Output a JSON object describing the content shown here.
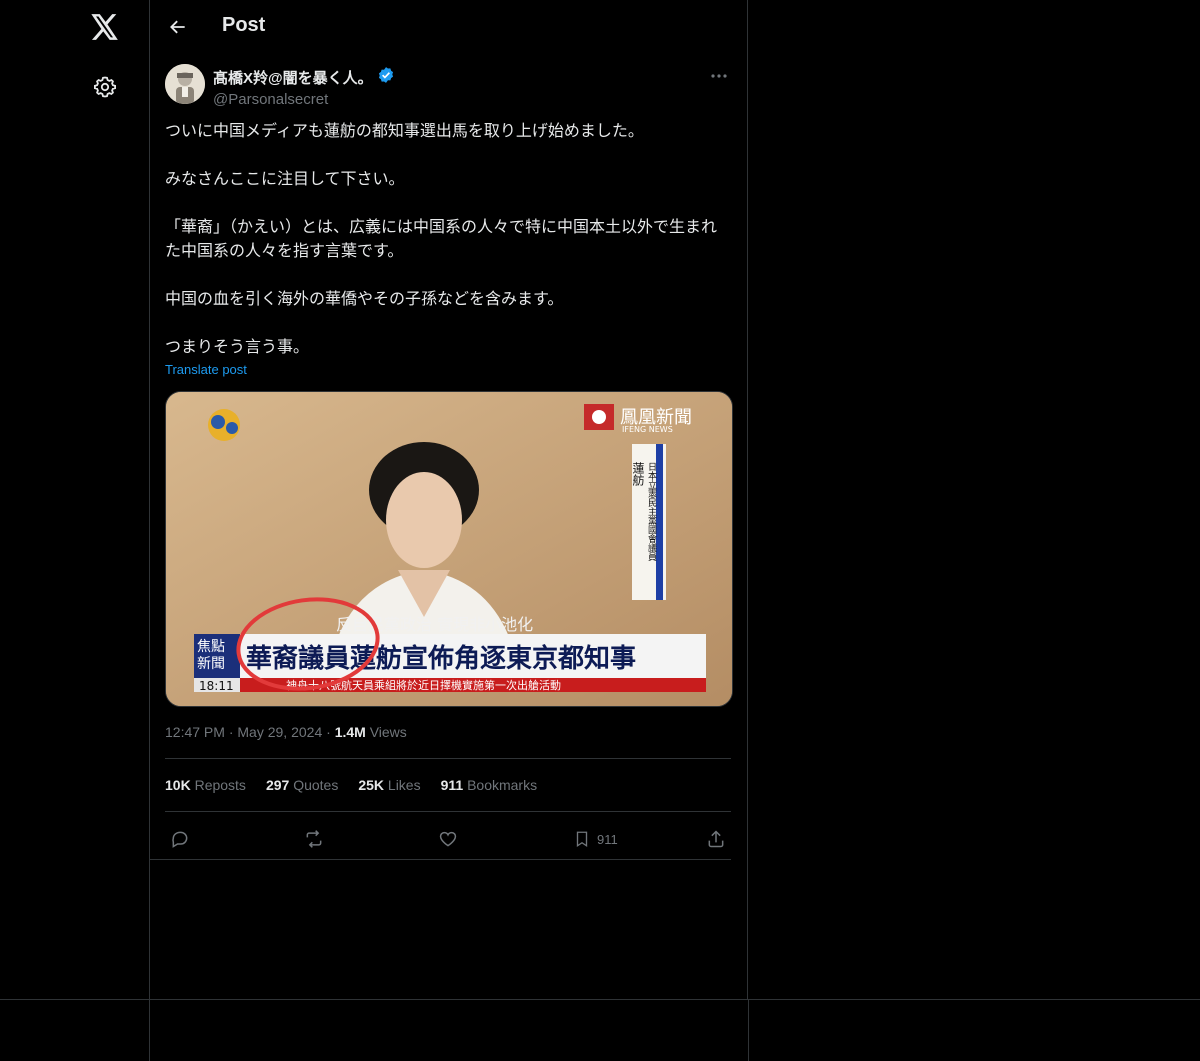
{
  "nav": {
    "logo_icon": "x-logo-icon",
    "settings_icon": "gear-icon"
  },
  "header": {
    "title": "Post"
  },
  "author": {
    "name": "髙橋X羚@闇を暴く人。",
    "handle": "@Parsonalsecret",
    "verified": true
  },
  "post": {
    "paragraphs": [
      "ついに中国メディアも蓮舫の都知事選出馬を取り上げ始めました。",
      "みなさんここに注目して下さい。",
      "「華裔」（かえい）とは、広義には中国系の人々で特に中国本土以外で生まれた中国系の人々を指す言葉です。",
      "中国の血を引く海外の華僑やその子孫などを含みます。",
      "つまりそう言う事。"
    ],
    "translate_label": "Translate post"
  },
  "media": {
    "logo_text": "鳳凰新聞",
    "logo_sub": "IFENG NEWS",
    "vertical_name": "蓮舫",
    "vertical_title": "日本立憲民主黨國會議員",
    "subtitle": "反自民黨政治 實現非小池化",
    "box_label_1": "焦點",
    "box_label_2": "新聞",
    "headline": "華裔議員蓮舫宣佈角逐東京都知事",
    "time": "18:11",
    "ticker": "神舟十八號航天員乘組將於近日擇機實施第一次出艙活動"
  },
  "meta": {
    "time": "12:47 PM",
    "date": "May 29, 2024",
    "views_count": "1.4M",
    "views_label": "Views"
  },
  "stats": [
    {
      "count": "10K",
      "label": "Reposts"
    },
    {
      "count": "297",
      "label": "Quotes"
    },
    {
      "count": "25K",
      "label": "Likes"
    },
    {
      "count": "911",
      "label": "Bookmarks"
    }
  ],
  "actions": {
    "bookmark_count": "911"
  },
  "colors": {
    "accent": "#1d9bf0",
    "background": "#000000",
    "border": "#2f3336",
    "muted": "#71767b"
  }
}
